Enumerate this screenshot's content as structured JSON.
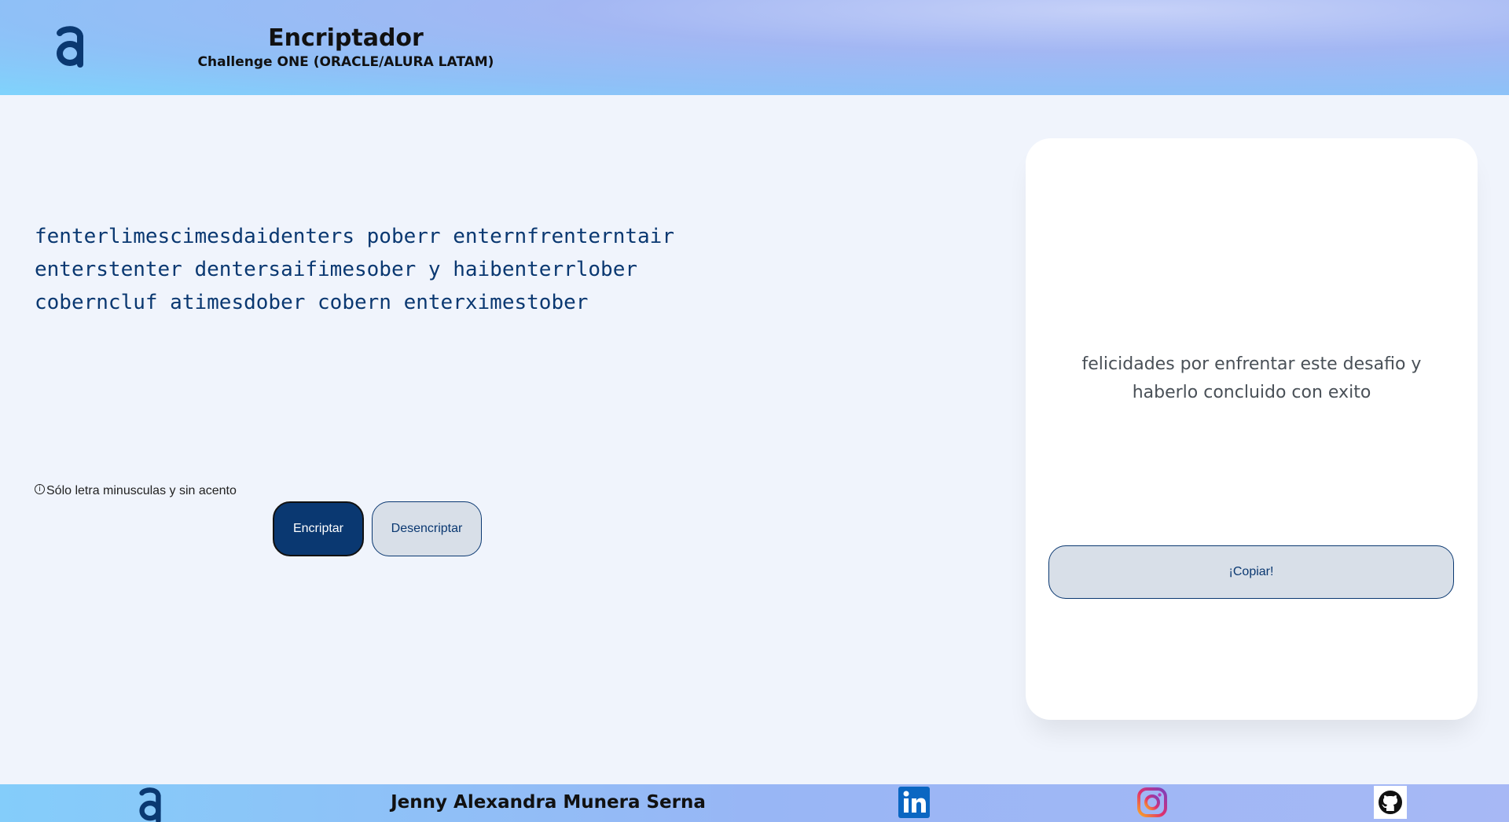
{
  "header": {
    "logo_icon": "alura-logo-icon",
    "title": "Encriptador",
    "subtitle": "Challenge ONE (ORACLE/ALURA LATAM)"
  },
  "input": {
    "text": "fenterlimescimesdaidenters poberr enternfrenterntair enterstenter dentersaifimesober y haibenterrlober coberncluf atimesdober cobern enterximestober",
    "hint_icon": "info-icon",
    "hint": "Sólo letra minusculas y sin acento"
  },
  "buttons": {
    "encrypt": "Encriptar",
    "decrypt": "Desencriptar",
    "copy": "¡Copiar!"
  },
  "output": {
    "text": "felicidades por enfrentar este desafio y haberlo concluido con exito"
  },
  "footer": {
    "logo_icon": "alura-logo-icon",
    "author": "Jenny Alexandra Munera Serna",
    "social": [
      {
        "name": "LinkedIn",
        "icon": "linkedin-icon"
      },
      {
        "name": "Instagram",
        "icon": "instagram-icon"
      },
      {
        "name": "GitHub",
        "icon": "github-icon"
      }
    ]
  },
  "colors": {
    "primary": "#0a3871",
    "background": "#f0f4fc",
    "secondary_button": "#d8dfe8",
    "output_text": "#495057"
  }
}
